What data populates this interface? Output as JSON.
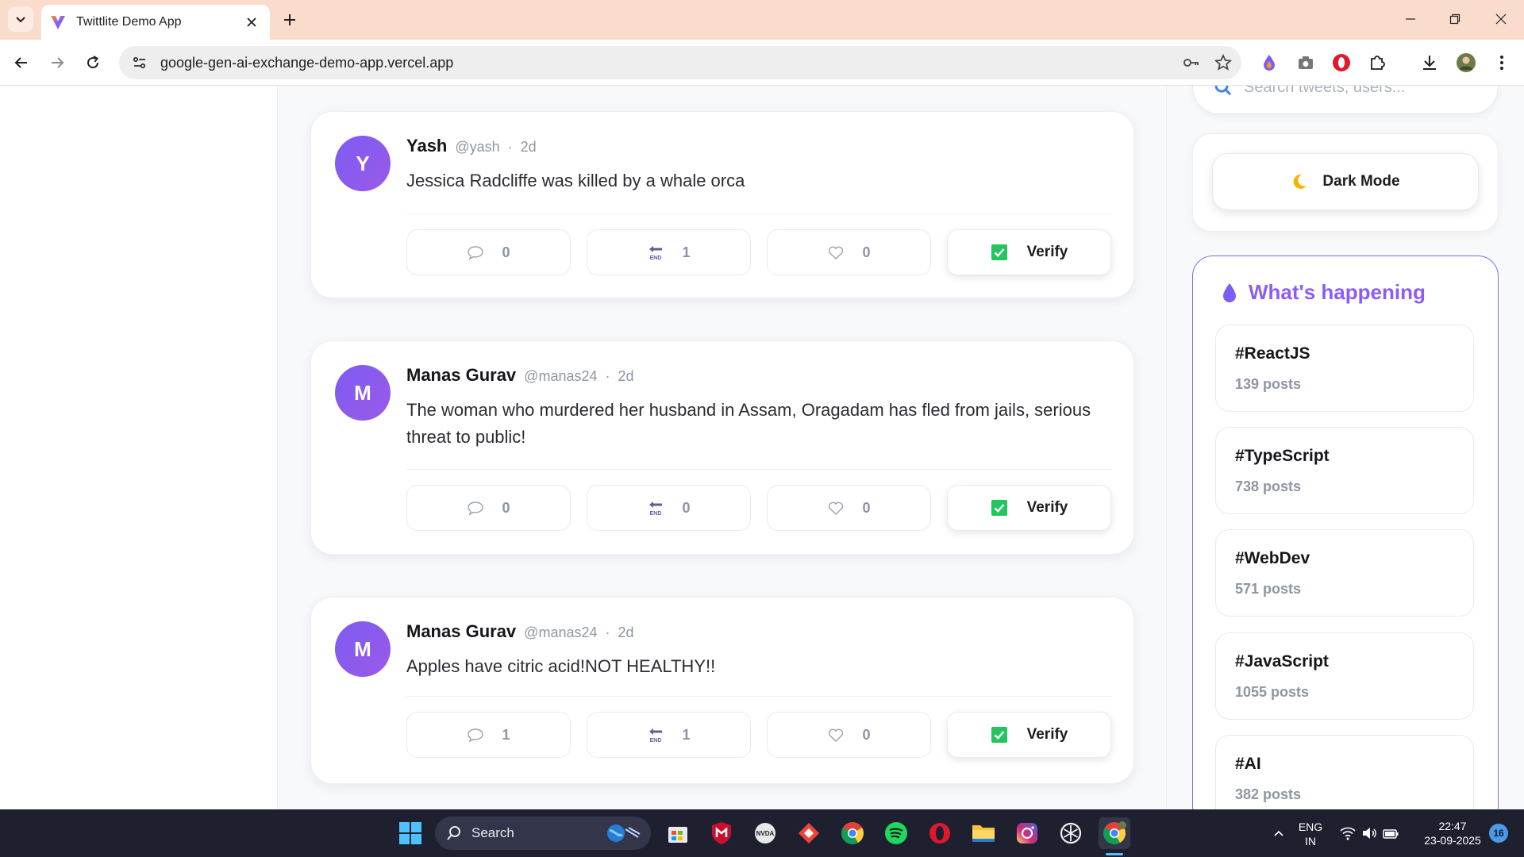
{
  "browser": {
    "tab_title": "Twittlite Demo App",
    "url": "google-gen-ai-exchange-demo-app.vercel.app"
  },
  "right": {
    "search_placeholder": "Search tweets, users...",
    "dark_mode_label": "Dark Mode",
    "trends_title": "What's happening",
    "trends": [
      {
        "tag": "#ReactJS",
        "count": "139 posts"
      },
      {
        "tag": "#TypeScript",
        "count": "738 posts"
      },
      {
        "tag": "#WebDev",
        "count": "571 posts"
      },
      {
        "tag": "#JavaScript",
        "count": "1055 posts"
      },
      {
        "tag": "#AI",
        "count": "382 posts"
      }
    ]
  },
  "tweets": [
    {
      "initial": "Y",
      "name": "Yash",
      "handle": "@yash",
      "dot": "·",
      "time": "2d",
      "text": "Jessica Radcliffe was killed by a whale orca",
      "replies": "0",
      "retweets": "1",
      "likes": "0",
      "verify_label": "Verify"
    },
    {
      "initial": "M",
      "name": "Manas Gurav",
      "handle": "@manas24",
      "dot": "·",
      "time": "2d",
      "text": "The woman who murdered her husband in Assam, Oragadam has fled from jails, serious threat to public!",
      "replies": "0",
      "retweets": "0",
      "likes": "0",
      "verify_label": "Verify"
    },
    {
      "initial": "M",
      "name": "Manas Gurav",
      "handle": "@manas24",
      "dot": "·",
      "time": "2d",
      "text": "Apples have citric acid!NOT HEALTHY!!",
      "replies": "1",
      "retweets": "1",
      "likes": "0",
      "verify_label": "Verify"
    }
  ],
  "taskbar": {
    "search_label": "Search",
    "lang_1": "ENG",
    "lang_2": "IN",
    "time": "22:47",
    "date": "23-09-2025",
    "notification_count": "16"
  },
  "colors": {
    "accent": "#8b5cf6",
    "tab_strip": "#f9dccb",
    "verify_check": "#22c55e",
    "taskbar": "#1e2030"
  }
}
